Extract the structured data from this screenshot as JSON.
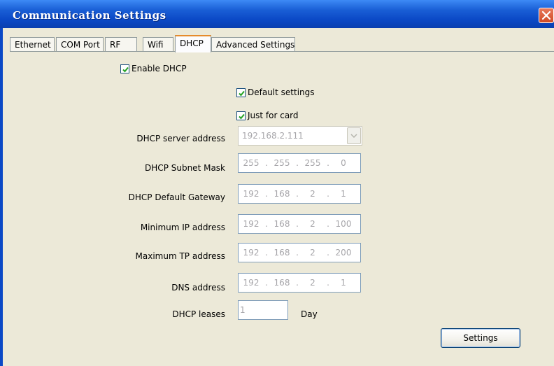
{
  "window": {
    "title": "Communication Settings"
  },
  "tabs": [
    {
      "label": "Ethernet"
    },
    {
      "label": "COM Port"
    },
    {
      "label": "RF"
    },
    {
      "label": "Wifi"
    },
    {
      "label": "DHCP",
      "active": true
    },
    {
      "label": "Advanced Settings"
    }
  ],
  "dhcp": {
    "enable_label": "Enable DHCP",
    "enable_checked": true,
    "default_settings_label": "Default settings",
    "default_settings_checked": true,
    "just_for_card_label": "Just for card",
    "just_for_card_checked": true,
    "server_address": {
      "label": "DHCP server address",
      "value": "192.168.2.111"
    },
    "subnet_mask": {
      "label": "DHCP Subnet Mask",
      "octets": [
        "255",
        "255",
        "255",
        "0"
      ]
    },
    "default_gateway": {
      "label": "DHCP Default Gateway",
      "octets": [
        "192",
        "168",
        "2",
        "1"
      ]
    },
    "min_ip": {
      "label": "Minimum IP address",
      "octets": [
        "192",
        "168",
        "2",
        "100"
      ]
    },
    "max_ip": {
      "label": "Maximum TP address",
      "octets": [
        "192",
        "168",
        "2",
        "200"
      ]
    },
    "dns": {
      "label": "DNS address",
      "octets": [
        "192",
        "168",
        "2",
        "1"
      ]
    },
    "leases": {
      "label": "DHCP leases",
      "value": "1",
      "unit": "Day"
    },
    "settings_button": "Settings"
  },
  "colors": {
    "title_bar": "#0b49c6",
    "dialog_bg": "#ece9d8",
    "close_button": "#d04a25",
    "tab_active_accent": "#e68b2c",
    "disabled_text": "#a7a6aa"
  }
}
